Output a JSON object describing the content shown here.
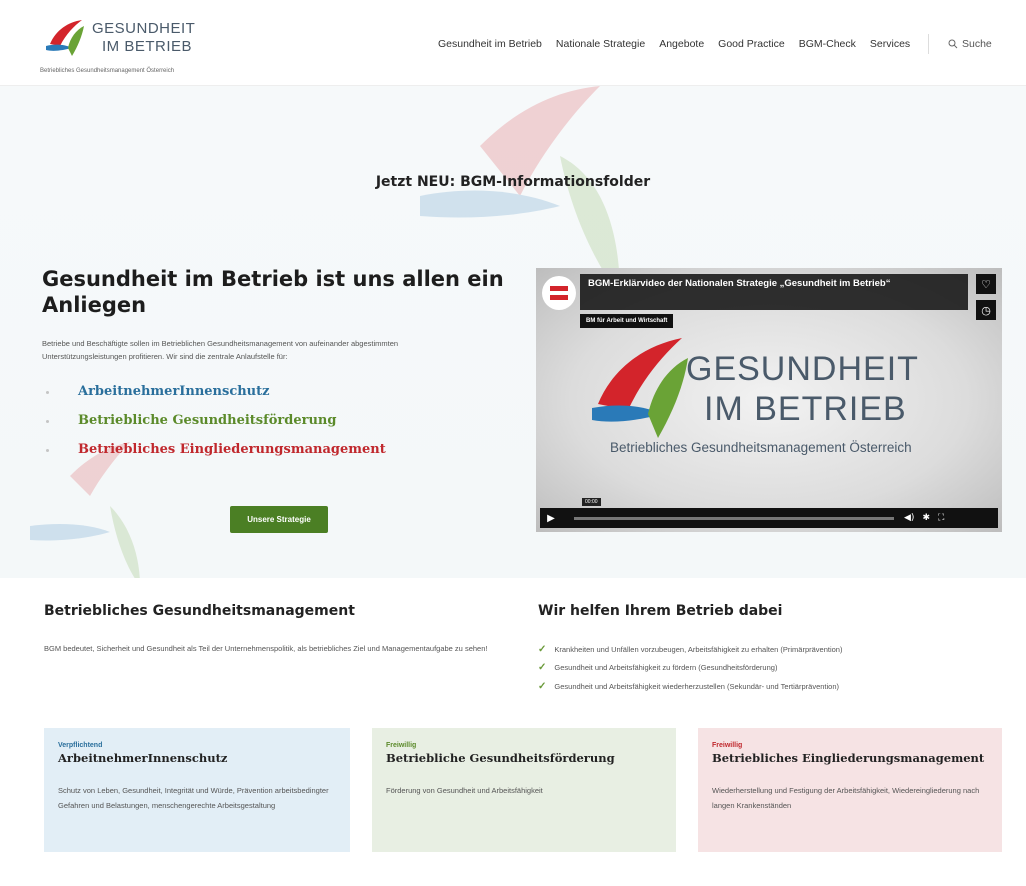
{
  "header": {
    "logo_line1": "GESUNDHEIT",
    "logo_line2": "IM BETRIEB",
    "logo_sub": "Betriebliches Gesundheitsmanagement Österreich",
    "nav": [
      "Gesundheit im Betrieb",
      "Nationale Strategie",
      "Angebote",
      "Good Practice",
      "BGM-Check",
      "Services"
    ],
    "search_label": "Suche"
  },
  "hero": {
    "announcement": "Jetzt NEU: BGM-Informationsfolder",
    "title": "Gesundheit im Betrieb ist uns allen ein Anliegen",
    "text": "Betriebe und Beschäftigte sollen im Betrieblichen Gesundheitsmanagement von aufeinander abgestimmten Unterstützungsleistungen profitieren. Wir sind die zentrale Anlaufstelle für:",
    "pillars": [
      "ArbeitnehmerInnenschutz",
      "Betriebliche Gesundheitsförderung",
      "Betriebliches Eingliederungsmanagement"
    ],
    "button_label": "Unsere Strategie"
  },
  "video": {
    "title": "BGM-Erklärvideo der Nationalen Strategie „Gesundheit im Betrieb“",
    "channel": "BM für Arbeit und Wirtschaft",
    "logo_line1": "GESUNDHEIT",
    "logo_line2": "IM BETRIEB",
    "logo_sub": "Betriebliches Gesundheitsmanagement Österreich",
    "time": "00:00",
    "icons": [
      "heart-icon",
      "clock-icon",
      "play-icon",
      "volume-icon",
      "settings-icon",
      "fullscreen-icon"
    ]
  },
  "bgm": {
    "title": "Betriebliches Gesundheitsmanagement",
    "text": "BGM bedeutet, Sicherheit und Gesundheit als Teil der Unternehmenspolitik, als betriebliches Ziel und Managementaufgabe zu sehen!"
  },
  "help": {
    "title": "Wir helfen Ihrem Betrieb dabei",
    "items": [
      "Krankheiten und Unfällen vorzubeugen, Arbeitsfähigkeit zu erhalten (Primärprävention)",
      "Gesundheit und Arbeitsfähigkeit zu fördern (Gesundheitsförderung)",
      "Gesundheit und Arbeitsfähigkeit wiederherzustellen (Sekundär- und Tertiärprävention)"
    ]
  },
  "cards": [
    {
      "kicker": "Verpflichtend",
      "title": "ArbeitnehmerInnenschutz",
      "text": "Schutz von Leben, Gesundheit, Integrität und Würde, Prävention arbeitsbedingter Gefahren und Belastungen, menschengerechte Arbeitsgestaltung"
    },
    {
      "kicker": "Freiwillig",
      "title": "Betriebliche Gesundheitsförderung",
      "text": "Förderung von Gesundheit und Arbeitsfähigkeit"
    },
    {
      "kicker": "Freiwillig",
      "title": "Betriebliches Eingliederungsmanagement",
      "text": "Wiederherstellung und Festigung der Arbeitsfähigkeit, Wiedereingliederung nach langen Krankenständen"
    }
  ],
  "colors": {
    "blue": "#2a6f9c",
    "green": "#5b8a2a",
    "red": "#c0282d",
    "button": "#4b7f24"
  }
}
